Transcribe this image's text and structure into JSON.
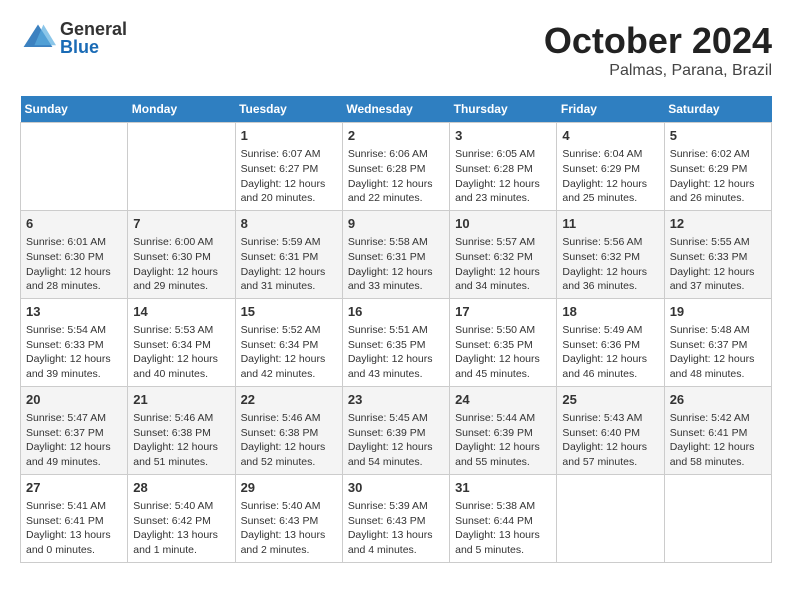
{
  "header": {
    "logo_general": "General",
    "logo_blue": "Blue",
    "month": "October 2024",
    "location": "Palmas, Parana, Brazil"
  },
  "weekdays": [
    "Sunday",
    "Monday",
    "Tuesday",
    "Wednesday",
    "Thursday",
    "Friday",
    "Saturday"
  ],
  "weeks": [
    [
      {
        "day": "",
        "info": ""
      },
      {
        "day": "",
        "info": ""
      },
      {
        "day": "1",
        "info": "Sunrise: 6:07 AM\nSunset: 6:27 PM\nDaylight: 12 hours and 20 minutes."
      },
      {
        "day": "2",
        "info": "Sunrise: 6:06 AM\nSunset: 6:28 PM\nDaylight: 12 hours and 22 minutes."
      },
      {
        "day": "3",
        "info": "Sunrise: 6:05 AM\nSunset: 6:28 PM\nDaylight: 12 hours and 23 minutes."
      },
      {
        "day": "4",
        "info": "Sunrise: 6:04 AM\nSunset: 6:29 PM\nDaylight: 12 hours and 25 minutes."
      },
      {
        "day": "5",
        "info": "Sunrise: 6:02 AM\nSunset: 6:29 PM\nDaylight: 12 hours and 26 minutes."
      }
    ],
    [
      {
        "day": "6",
        "info": "Sunrise: 6:01 AM\nSunset: 6:30 PM\nDaylight: 12 hours and 28 minutes."
      },
      {
        "day": "7",
        "info": "Sunrise: 6:00 AM\nSunset: 6:30 PM\nDaylight: 12 hours and 29 minutes."
      },
      {
        "day": "8",
        "info": "Sunrise: 5:59 AM\nSunset: 6:31 PM\nDaylight: 12 hours and 31 minutes."
      },
      {
        "day": "9",
        "info": "Sunrise: 5:58 AM\nSunset: 6:31 PM\nDaylight: 12 hours and 33 minutes."
      },
      {
        "day": "10",
        "info": "Sunrise: 5:57 AM\nSunset: 6:32 PM\nDaylight: 12 hours and 34 minutes."
      },
      {
        "day": "11",
        "info": "Sunrise: 5:56 AM\nSunset: 6:32 PM\nDaylight: 12 hours and 36 minutes."
      },
      {
        "day": "12",
        "info": "Sunrise: 5:55 AM\nSunset: 6:33 PM\nDaylight: 12 hours and 37 minutes."
      }
    ],
    [
      {
        "day": "13",
        "info": "Sunrise: 5:54 AM\nSunset: 6:33 PM\nDaylight: 12 hours and 39 minutes."
      },
      {
        "day": "14",
        "info": "Sunrise: 5:53 AM\nSunset: 6:34 PM\nDaylight: 12 hours and 40 minutes."
      },
      {
        "day": "15",
        "info": "Sunrise: 5:52 AM\nSunset: 6:34 PM\nDaylight: 12 hours and 42 minutes."
      },
      {
        "day": "16",
        "info": "Sunrise: 5:51 AM\nSunset: 6:35 PM\nDaylight: 12 hours and 43 minutes."
      },
      {
        "day": "17",
        "info": "Sunrise: 5:50 AM\nSunset: 6:35 PM\nDaylight: 12 hours and 45 minutes."
      },
      {
        "day": "18",
        "info": "Sunrise: 5:49 AM\nSunset: 6:36 PM\nDaylight: 12 hours and 46 minutes."
      },
      {
        "day": "19",
        "info": "Sunrise: 5:48 AM\nSunset: 6:37 PM\nDaylight: 12 hours and 48 minutes."
      }
    ],
    [
      {
        "day": "20",
        "info": "Sunrise: 5:47 AM\nSunset: 6:37 PM\nDaylight: 12 hours and 49 minutes."
      },
      {
        "day": "21",
        "info": "Sunrise: 5:46 AM\nSunset: 6:38 PM\nDaylight: 12 hours and 51 minutes."
      },
      {
        "day": "22",
        "info": "Sunrise: 5:46 AM\nSunset: 6:38 PM\nDaylight: 12 hours and 52 minutes."
      },
      {
        "day": "23",
        "info": "Sunrise: 5:45 AM\nSunset: 6:39 PM\nDaylight: 12 hours and 54 minutes."
      },
      {
        "day": "24",
        "info": "Sunrise: 5:44 AM\nSunset: 6:39 PM\nDaylight: 12 hours and 55 minutes."
      },
      {
        "day": "25",
        "info": "Sunrise: 5:43 AM\nSunset: 6:40 PM\nDaylight: 12 hours and 57 minutes."
      },
      {
        "day": "26",
        "info": "Sunrise: 5:42 AM\nSunset: 6:41 PM\nDaylight: 12 hours and 58 minutes."
      }
    ],
    [
      {
        "day": "27",
        "info": "Sunrise: 5:41 AM\nSunset: 6:41 PM\nDaylight: 13 hours and 0 minutes."
      },
      {
        "day": "28",
        "info": "Sunrise: 5:40 AM\nSunset: 6:42 PM\nDaylight: 13 hours and 1 minute."
      },
      {
        "day": "29",
        "info": "Sunrise: 5:40 AM\nSunset: 6:43 PM\nDaylight: 13 hours and 2 minutes."
      },
      {
        "day": "30",
        "info": "Sunrise: 5:39 AM\nSunset: 6:43 PM\nDaylight: 13 hours and 4 minutes."
      },
      {
        "day": "31",
        "info": "Sunrise: 5:38 AM\nSunset: 6:44 PM\nDaylight: 13 hours and 5 minutes."
      },
      {
        "day": "",
        "info": ""
      },
      {
        "day": "",
        "info": ""
      }
    ]
  ]
}
